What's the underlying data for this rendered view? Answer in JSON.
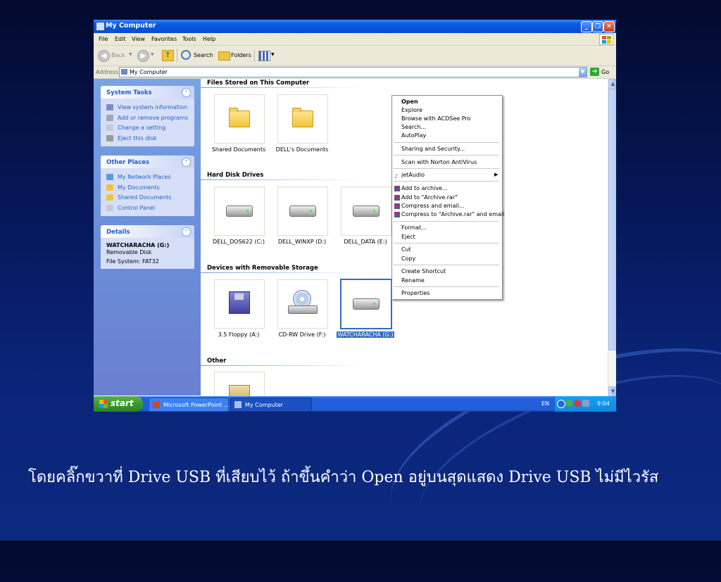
{
  "window": {
    "title": "My Computer",
    "buttons": {
      "minimize": "_",
      "maximize": "❐",
      "close": "✕"
    }
  },
  "menubar": [
    "File",
    "Edit",
    "View",
    "Favorites",
    "Tools",
    "Help"
  ],
  "toolbar": {
    "back": "Back",
    "forward": "",
    "search": "Search",
    "folders": "Folders"
  },
  "address": {
    "label": "Address",
    "value": "My Computer",
    "go": "Go"
  },
  "left_pane": {
    "system_tasks": {
      "title": "System Tasks",
      "items": [
        "View system information",
        "Add or remove programs",
        "Change a setting",
        "Eject this disk"
      ]
    },
    "other_places": {
      "title": "Other Places",
      "items": [
        "My Network Places",
        "My Documents",
        "Shared Documents",
        "Control Panel"
      ]
    },
    "details": {
      "title": "Details",
      "name": "WATCHARACHA (G:)",
      "type": "Removable Disk",
      "fs": "File System: FAT32"
    }
  },
  "main": {
    "sections": {
      "files": "Files Stored on This Computer",
      "hdd": "Hard Disk Drives",
      "removable": "Devices with Removable Storage",
      "other": "Other"
    },
    "files": [
      "Shared Documents",
      "DELL's Documents"
    ],
    "hdd": [
      "DELL_DOS622 (C:)",
      "DELL_WINXP (D:)",
      "DELL_DATA (E:)"
    ],
    "removable": [
      "3.5 Floppy (A:)",
      "CD-RW Drive (F:)",
      "WATCHARACHA (G:)"
    ]
  },
  "context_menu": {
    "open": "Open",
    "explore": "Explore",
    "acdsee": "Browse with ACDSee Pro",
    "search": "Search...",
    "autoplay": "AutoPlay",
    "sharing": "Sharing and Security...",
    "norton": "Scan with Norton AntiVirus",
    "jetaudio": "jetAudio",
    "add_archive": "Add to archive...",
    "add_rar": "Add to \"Archive.rar\"",
    "compress_email": "Compress and email...",
    "compress_rar_email": "Compress to \"Archive.rar\" and email",
    "format": "Format...",
    "eject": "Eject",
    "cut": "Cut",
    "copy": "Copy",
    "shortcut": "Create Shortcut",
    "rename": "Rename",
    "properties": "Properties"
  },
  "taskbar": {
    "start": "start",
    "tasks": [
      "Microsoft PowerPoint ...",
      "My Computer"
    ],
    "lang": "EN",
    "time": "9:04"
  },
  "caption": "โดยคลิ๊กขวาที่ Drive USB ที่เสียบไว้  ถ้าขึ้นคำว่า Open อยู่บนสุดแสดง Drive USB ไม่มีไวรัส",
  "colors": {
    "title_blue": "#0653d8",
    "link_blue": "#215dc6",
    "selection": "#316ac5",
    "start_green": "#3a9a2e"
  }
}
